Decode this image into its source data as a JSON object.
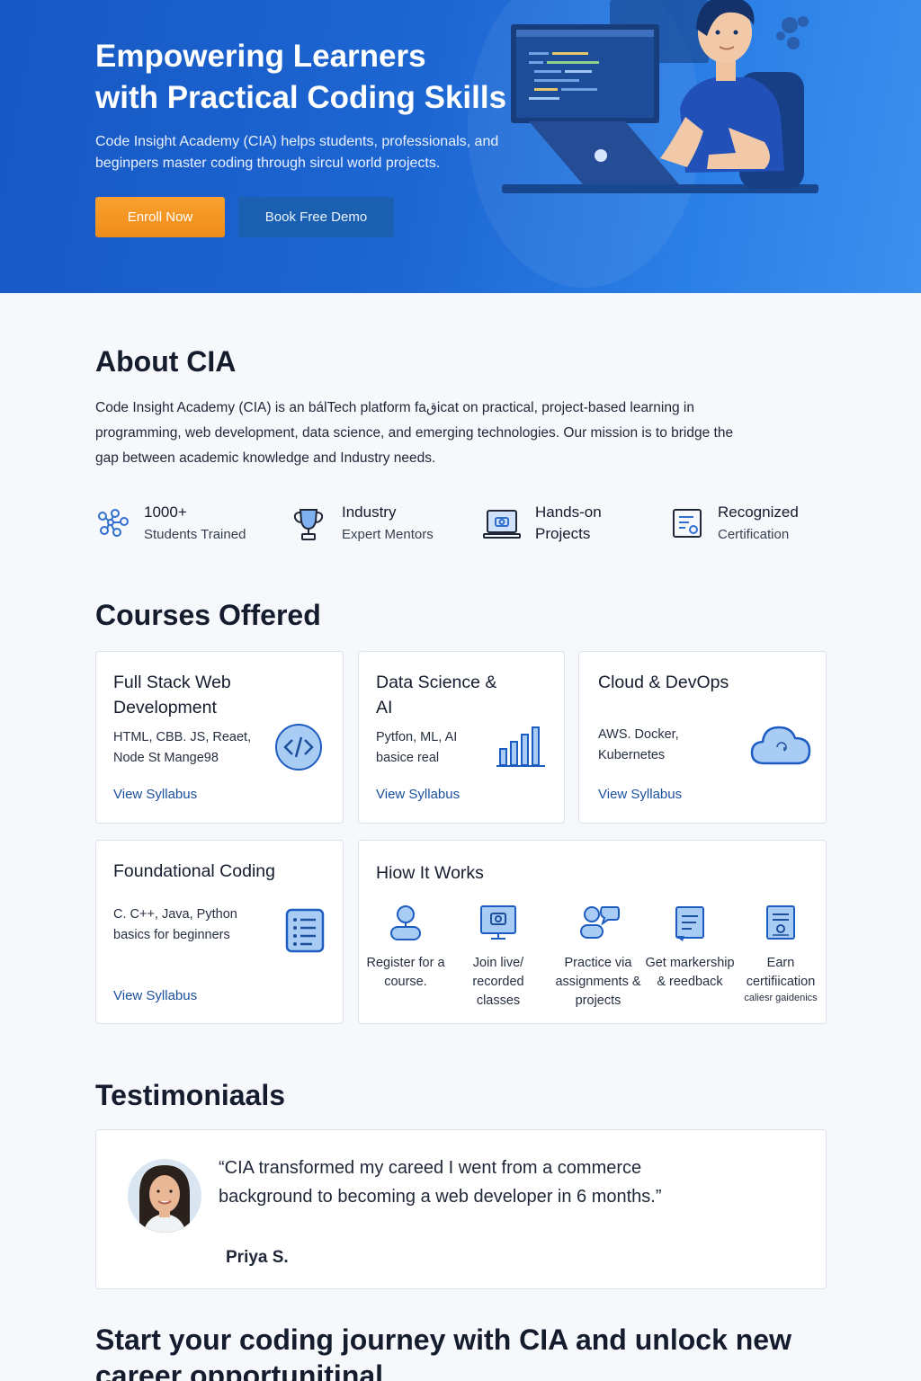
{
  "hero": {
    "title_line1": "Empowering Learners",
    "title_line2": "with Practical Coding Skills",
    "subtitle": "Code Insight Academy (CIA) helps students, professionals, and beginpers master coding through sircul world projects.",
    "enroll_label": "Enroll Now",
    "demo_label": "Book Free Demo"
  },
  "about": {
    "heading": "About CIA",
    "body": "Code Insight Academy (CIA) is an bálTech platform faقicat on practical, project-based learning in programming, web development, data science, and emerging technologies. Our mission is to bridge the gap between academic knowledge and Industry needs.",
    "stats": [
      {
        "icon": "network-icon",
        "line1": "1000+",
        "line2": "Students Trained"
      },
      {
        "icon": "trophy-icon",
        "line1": "Industry",
        "line2": "Expert Mentors"
      },
      {
        "icon": "laptop-icon",
        "line1": "Hands-on",
        "line2": "Projects"
      },
      {
        "icon": "certificate-icon",
        "line1": "Recognized",
        "line2": "Certification"
      }
    ]
  },
  "courses": {
    "heading": "Courses Offered",
    "items": [
      {
        "title": "Full Stack Web Development",
        "desc": "HTML, CBB. JS, Reaet, Node St Mange98",
        "link": "View Syllabus",
        "icon": "code-icon"
      },
      {
        "title": "Data Science & AI",
        "desc": "Pytfon, ML, AI basice real",
        "link": "View Syllabus",
        "icon": "bar-chart-icon"
      },
      {
        "title": "Cloud & DevOps",
        "desc": "AWS. Docker, Kubernetes",
        "link": "View Syllabus",
        "icon": "cloud-icon"
      },
      {
        "title": "Foundational Coding",
        "desc": "C. C++, Java, Python basics for beginners",
        "link": "View Syllabus",
        "icon": "document-list-icon"
      }
    ]
  },
  "how": {
    "heading": "Hiow It Works",
    "steps": [
      {
        "icon": "user-icon",
        "label": "Register for a course."
      },
      {
        "icon": "monitor-icon",
        "label": "Join live/ recorded classes"
      },
      {
        "icon": "chat-users-icon",
        "label": "Practice via assignments & projects"
      },
      {
        "icon": "clipboard-icon",
        "label": "Get markership & reedback"
      },
      {
        "icon": "certificate-icon",
        "label": "Earn certifiication",
        "sublabel": "caliesr gaidenics"
      }
    ]
  },
  "testimonials": {
    "heading": "Testimoniaals",
    "quote": "“CIA transformed my careed I went from a commerce background to becoming a web developer in 6 months.”",
    "author": "Priya S."
  },
  "cta": {
    "text": "Start your coding journey with CIA and unlock new career opportunitinal"
  },
  "colors": {
    "hero_blue": "#1d66d2",
    "accent_orange": "#f39521",
    "link_blue": "#1a4f9c",
    "icon_blue": "#2f6fd0"
  }
}
